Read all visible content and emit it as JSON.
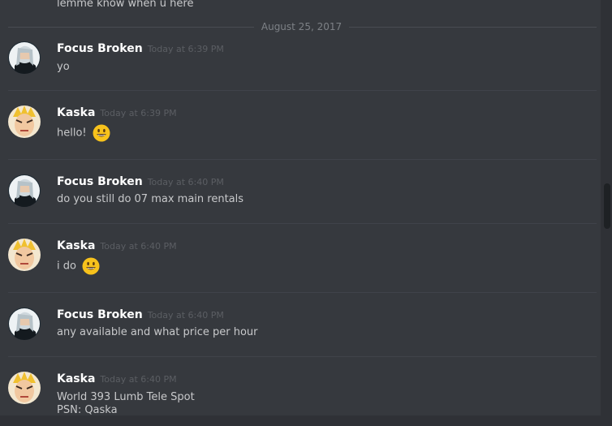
{
  "chat": {
    "partial_top_message": "lemme know when u here",
    "date_divider": "August 25, 2017",
    "messages": [
      {
        "author": "Focus Broken",
        "timestamp": "Today at 6:39 PM",
        "text": "yo",
        "emoji": ""
      },
      {
        "author": "Kaska",
        "timestamp": "Today at 6:39 PM",
        "text": "hello!",
        "emoji": "smiley"
      },
      {
        "author": "Focus Broken",
        "timestamp": "Today at 6:40 PM",
        "text": "do you still do 07 max main rentals",
        "emoji": ""
      },
      {
        "author": "Kaska",
        "timestamp": "Today at 6:40 PM",
        "text": "i do",
        "emoji": "smiley"
      },
      {
        "author": "Focus Broken",
        "timestamp": "Today at 6:40 PM",
        "text": "any available and what price per hour",
        "emoji": ""
      },
      {
        "author": "Kaska",
        "timestamp": "Today at 6:40 PM",
        "text": "World 393 Lumb Tele Spot",
        "text2": "PSN: Qaska",
        "emoji": ""
      }
    ]
  },
  "colors": {
    "background": "#36393e",
    "author": "#ffffff",
    "text": "#c8c9cb",
    "timestamp": "#5b5e63",
    "divider": "#494c52"
  }
}
